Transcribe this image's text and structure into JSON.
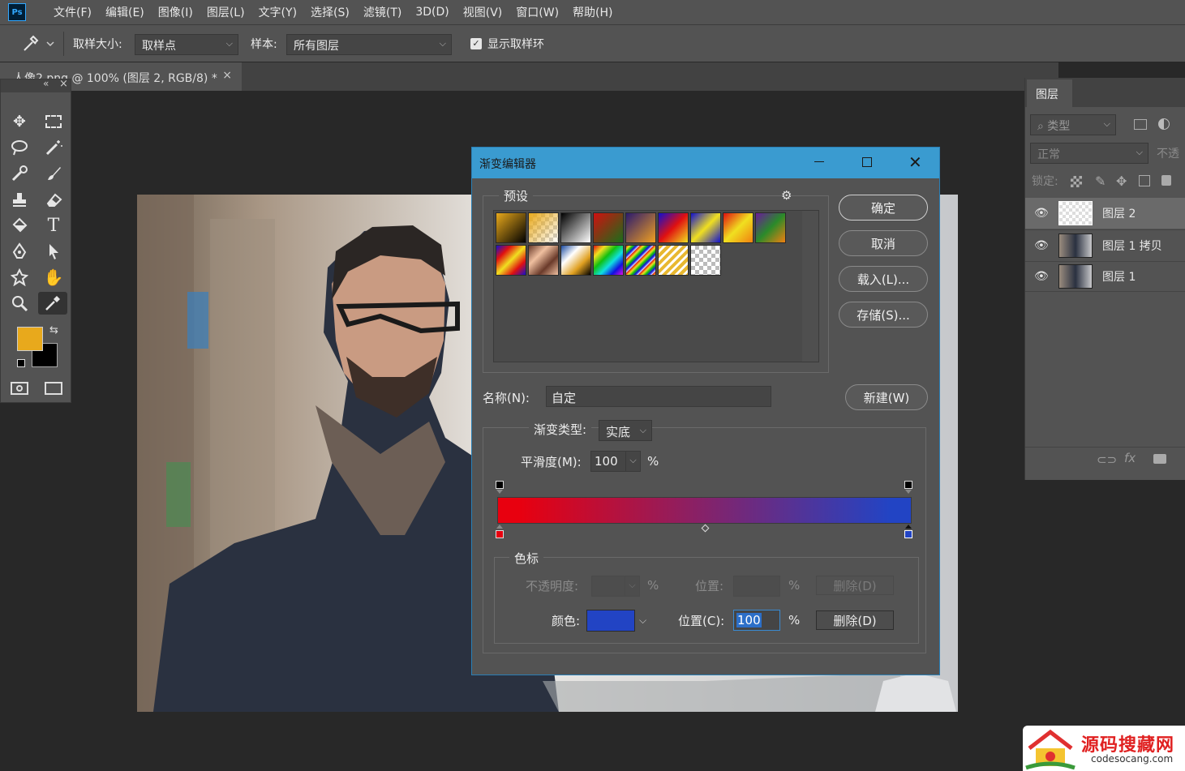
{
  "app": {
    "logo": "Ps"
  },
  "menu": [
    "文件(F)",
    "编辑(E)",
    "图像(I)",
    "图层(L)",
    "文字(Y)",
    "选择(S)",
    "滤镜(T)",
    "3D(D)",
    "视图(V)",
    "窗口(W)",
    "帮助(H)"
  ],
  "options": {
    "sample_size_label": "取样大小:",
    "sample_size_value": "取样点",
    "sample_label": "样本:",
    "sample_value": "所有图层",
    "show_ring_label": "显示取样环",
    "show_ring_checked": true
  },
  "document_tab": {
    "title": "人像2.png @ 100% (图层 2, RGB/8) *",
    "close": "×"
  },
  "toolbox": {
    "collapse": "«",
    "close": "×",
    "foreground_color": "#e8a91c",
    "background_color": "#000000"
  },
  "layers_panel": {
    "tab": "图层",
    "filter_label": "类型",
    "blend_mode": "正常",
    "opacity_label": "不透",
    "lock_label": "锁定:",
    "layers": [
      {
        "name": "图层 2",
        "selected": true
      },
      {
        "name": "图层 1 拷贝",
        "selected": false
      },
      {
        "name": "图层 1",
        "selected": false
      }
    ]
  },
  "gradient_editor": {
    "title": "渐变编辑器",
    "presets_label": "预设",
    "buttons": {
      "ok": "确定",
      "cancel": "取消",
      "load": "载入(L)...",
      "save": "存储(S)...",
      "new": "新建(W)"
    },
    "name_label": "名称(N):",
    "name_value": "自定",
    "type_label": "渐变类型:",
    "type_value": "实底",
    "smoothness_label": "平滑度(M):",
    "smoothness_value": "100",
    "percent": "%",
    "gradient": {
      "start_color": "#e8000f",
      "end_color": "#2244c4"
    },
    "stops_group_label": "色标",
    "opacity_label": "不透明度:",
    "opacity_position_label": "位置:",
    "opacity_delete": "删除(D)",
    "color_label": "颜色:",
    "color_value": "#2244c4",
    "color_position_label": "位置(C):",
    "color_position_value": "100",
    "color_delete": "删除(D)"
  },
  "watermark": {
    "title": "源码搜藏网",
    "url": "codesocang.com"
  }
}
